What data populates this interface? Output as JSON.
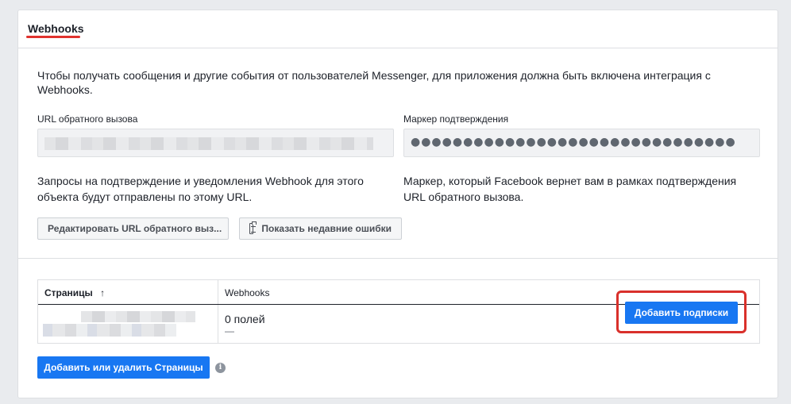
{
  "section": {
    "title": "Webhooks",
    "intro": "Чтобы получать сообщения и другие события от пользователей Messenger, для приложения должна быть включена интеграция с Webhooks."
  },
  "callback_url": {
    "label": "URL обратного вызова",
    "help": "Запросы на подтверждение и уведомления Webhook для этого объекта будут отправлены по этому URL."
  },
  "verify_token": {
    "label": "Маркер подтверждения",
    "value_masked": "●●●●●●●●●●●●●●●●●●●●●●●●●●●●●●●",
    "help": "Маркер, который Facebook вернет вам в рамках подтверждения URL обратного вызова."
  },
  "buttons": {
    "edit_callback": "Редактировать URL обратного выз...",
    "show_errors": "Показать недавние ошибки",
    "add_subscriptions": "Добавить подписки",
    "add_remove_pages": "Добавить или удалить Страницы"
  },
  "table": {
    "col_pages": "Страницы",
    "sort_indicator": "↑",
    "col_webhooks": "Webhooks",
    "rows": [
      {
        "fields": "0 полей",
        "dash": "—"
      }
    ]
  },
  "colors": {
    "primary": "#1877f2",
    "highlight": "#d9302b",
    "background": "#e9ebee"
  },
  "icons": [
    "clipboard-icon",
    "info-icon",
    "sort-up-icon"
  ]
}
